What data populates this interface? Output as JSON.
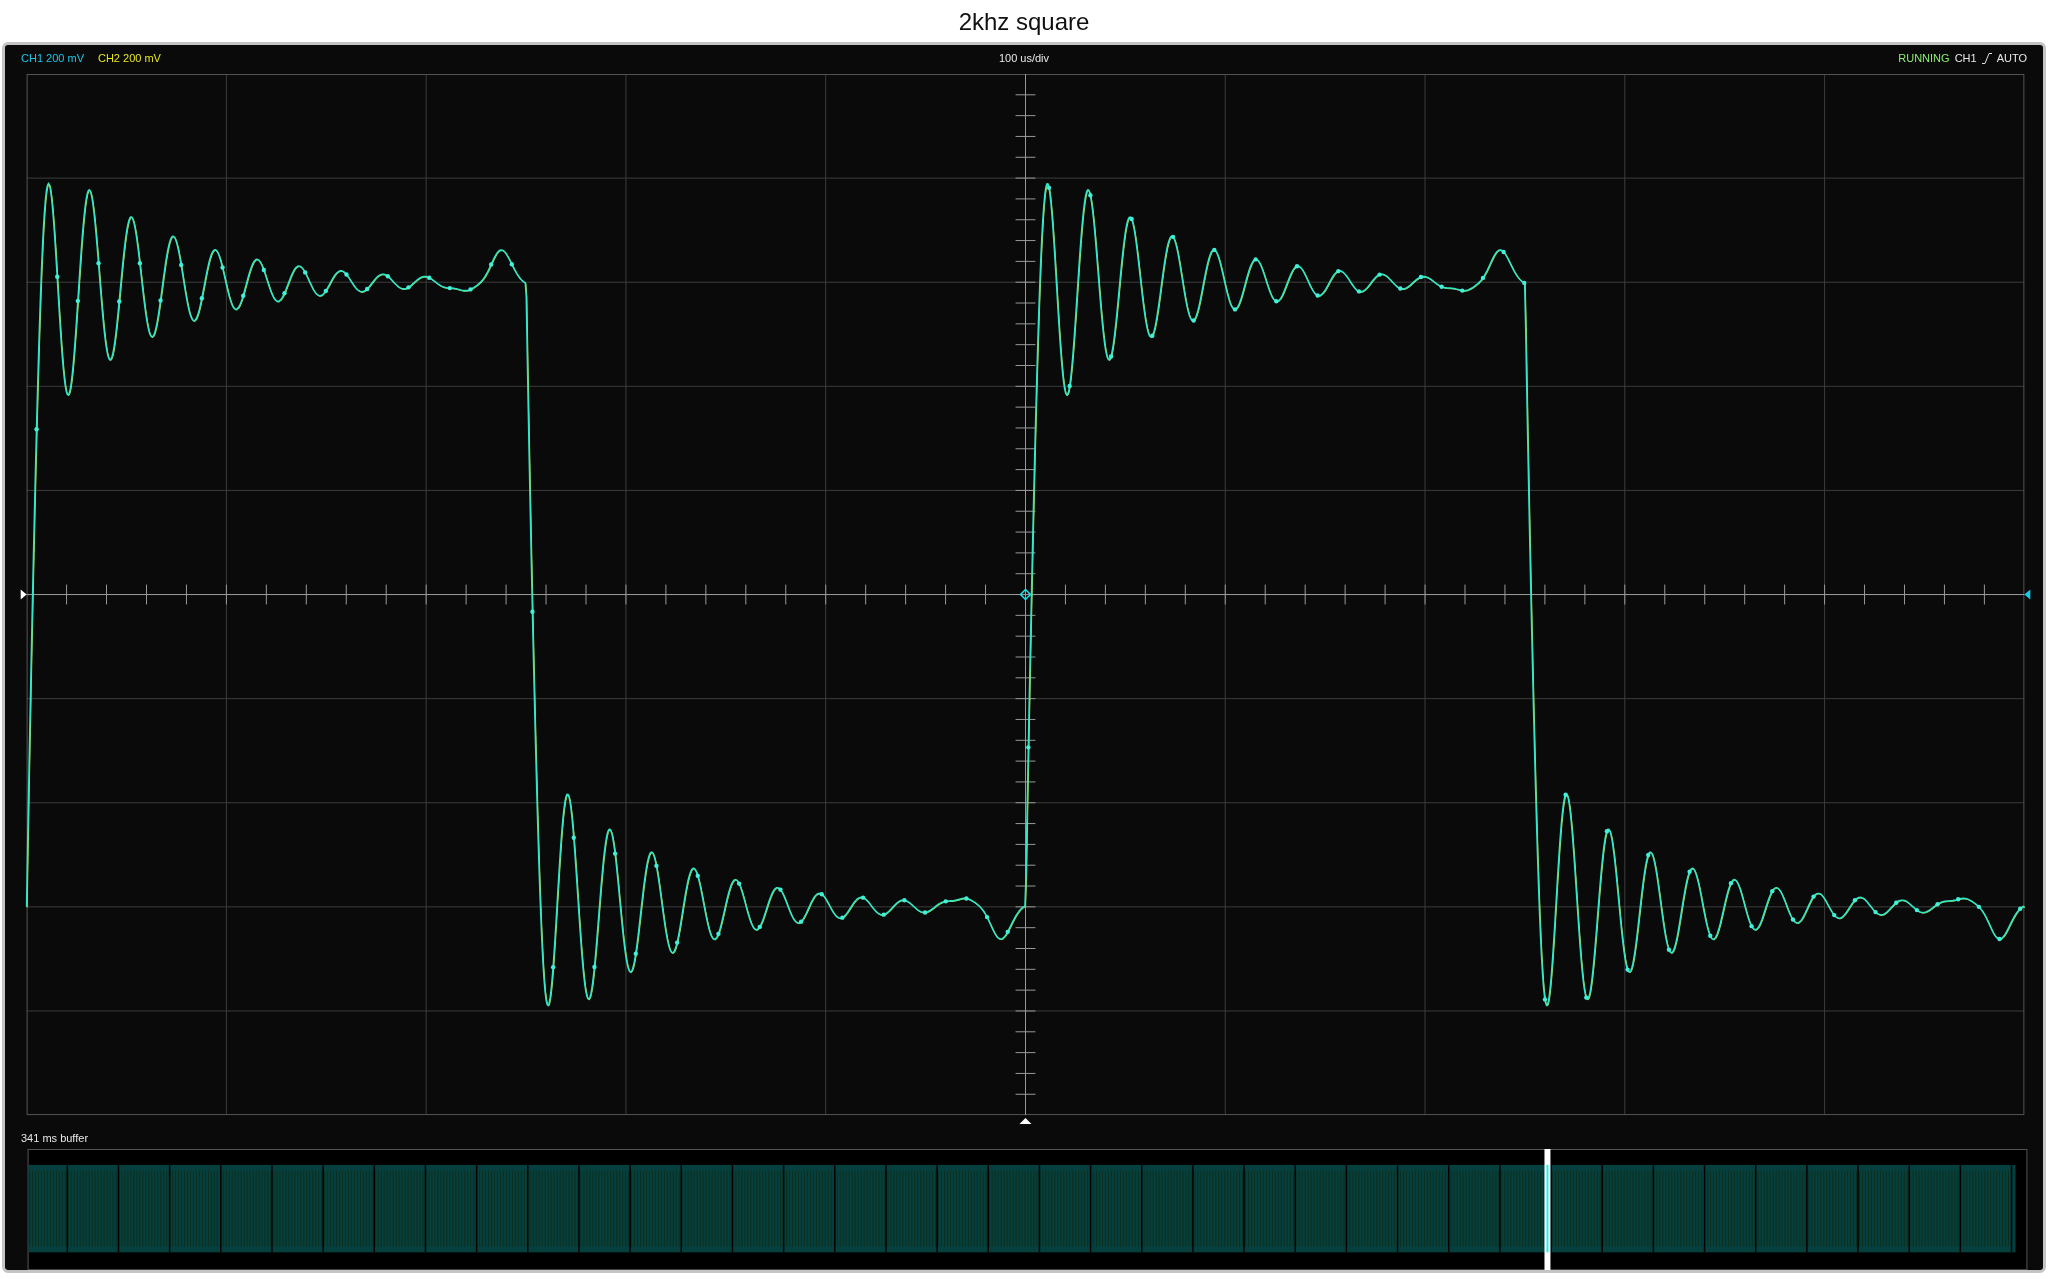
{
  "title": "2khz square",
  "scope": {
    "channels": [
      {
        "label": "CH1 200 mV",
        "color": "#19c8e6"
      },
      {
        "label": "CH2 200 mV",
        "color": "#e6e619"
      }
    ],
    "timebase": "100 us/div",
    "status": {
      "state": "RUNNING",
      "trigger_source": "CH1",
      "trigger_mode": "AUTO"
    },
    "buffer": {
      "label": "341 ms buffer",
      "level": 0.76
    }
  }
}
